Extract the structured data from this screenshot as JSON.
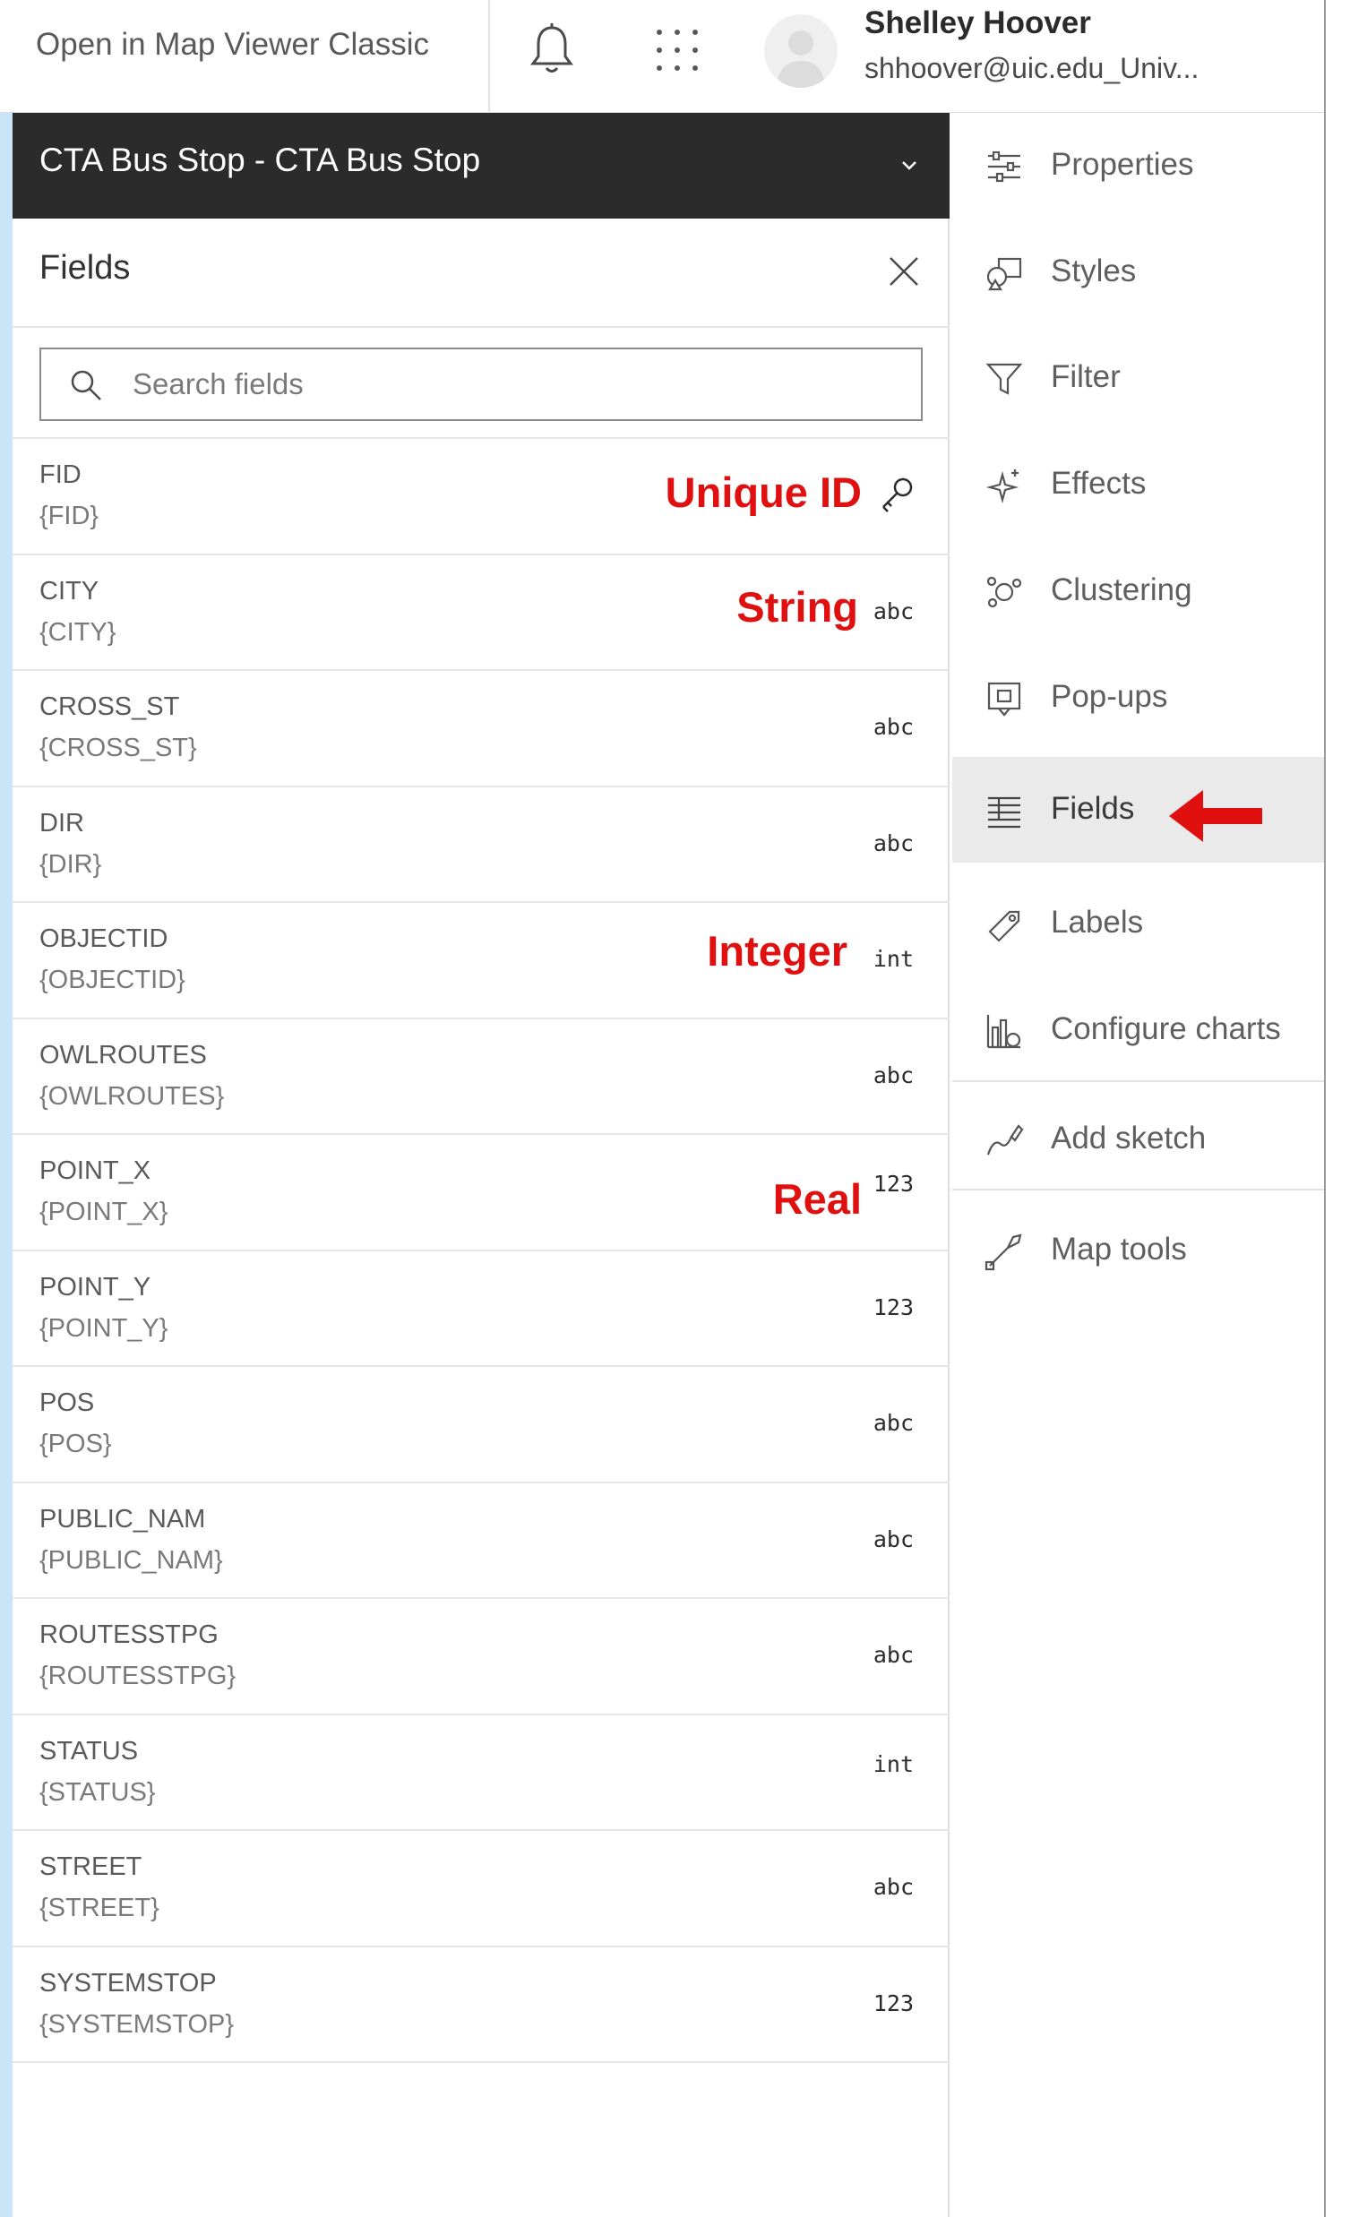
{
  "header": {
    "open_classic": "Open in Map Viewer Classic",
    "user_name": "Shelley Hoover",
    "user_email": "shhoover@uic.edu_Univ..."
  },
  "layer": {
    "title": "CTA Bus Stop - CTA Bus Stop"
  },
  "panel": {
    "title": "Fields",
    "search_placeholder": "Search fields"
  },
  "fields": [
    {
      "name": "FID",
      "expr": "{FID}",
      "type": "key",
      "annotation": "Unique ID"
    },
    {
      "name": "CITY",
      "expr": "{CITY}",
      "type": "abc",
      "annotation": "String"
    },
    {
      "name": "CROSS_ST",
      "expr": "{CROSS_ST}",
      "type": "abc"
    },
    {
      "name": "DIR",
      "expr": "{DIR}",
      "type": "abc"
    },
    {
      "name": "OBJECTID",
      "expr": "{OBJECTID}",
      "type": "int",
      "annotation": "Integer"
    },
    {
      "name": "OWLROUTES",
      "expr": "{OWLROUTES}",
      "type": "abc"
    },
    {
      "name": "POINT_X",
      "expr": "{POINT_X}",
      "type": "123",
      "annotation": "Real"
    },
    {
      "name": "POINT_Y",
      "expr": "{POINT_Y}",
      "type": "123"
    },
    {
      "name": "POS",
      "expr": "{POS}",
      "type": "abc"
    },
    {
      "name": "PUBLIC_NAM",
      "expr": "{PUBLIC_NAM}",
      "type": "abc"
    },
    {
      "name": "ROUTESSTPG",
      "expr": "{ROUTESSTPG}",
      "type": "abc"
    },
    {
      "name": "STATUS",
      "expr": "{STATUS}",
      "type": "int"
    },
    {
      "name": "STREET",
      "expr": "{STREET}",
      "type": "abc"
    },
    {
      "name": "SYSTEMSTOP",
      "expr": "{SYSTEMSTOP}",
      "type": "123"
    }
  ],
  "nav": {
    "items": [
      {
        "label": "Properties",
        "icon": "properties-icon"
      },
      {
        "label": "Styles",
        "icon": "styles-icon"
      },
      {
        "label": "Filter",
        "icon": "filter-icon"
      },
      {
        "label": "Effects",
        "icon": "effects-icon"
      },
      {
        "label": "Clustering",
        "icon": "clustering-icon"
      },
      {
        "label": "Pop-ups",
        "icon": "popups-icon"
      },
      {
        "label": "Fields",
        "icon": "fields-icon",
        "active": true
      },
      {
        "label": "Labels",
        "icon": "labels-icon"
      },
      {
        "label": "Configure charts",
        "icon": "charts-icon"
      },
      {
        "label": "Add sketch",
        "icon": "sketch-icon"
      },
      {
        "label": "Map tools",
        "icon": "map-tools-icon"
      }
    ]
  },
  "colors": {
    "layer_header_bg": "#2b2b2b",
    "annotation_red": "#e01010",
    "active_nav_bg": "#eaeaea",
    "left_strip": "#c8e6f7"
  }
}
